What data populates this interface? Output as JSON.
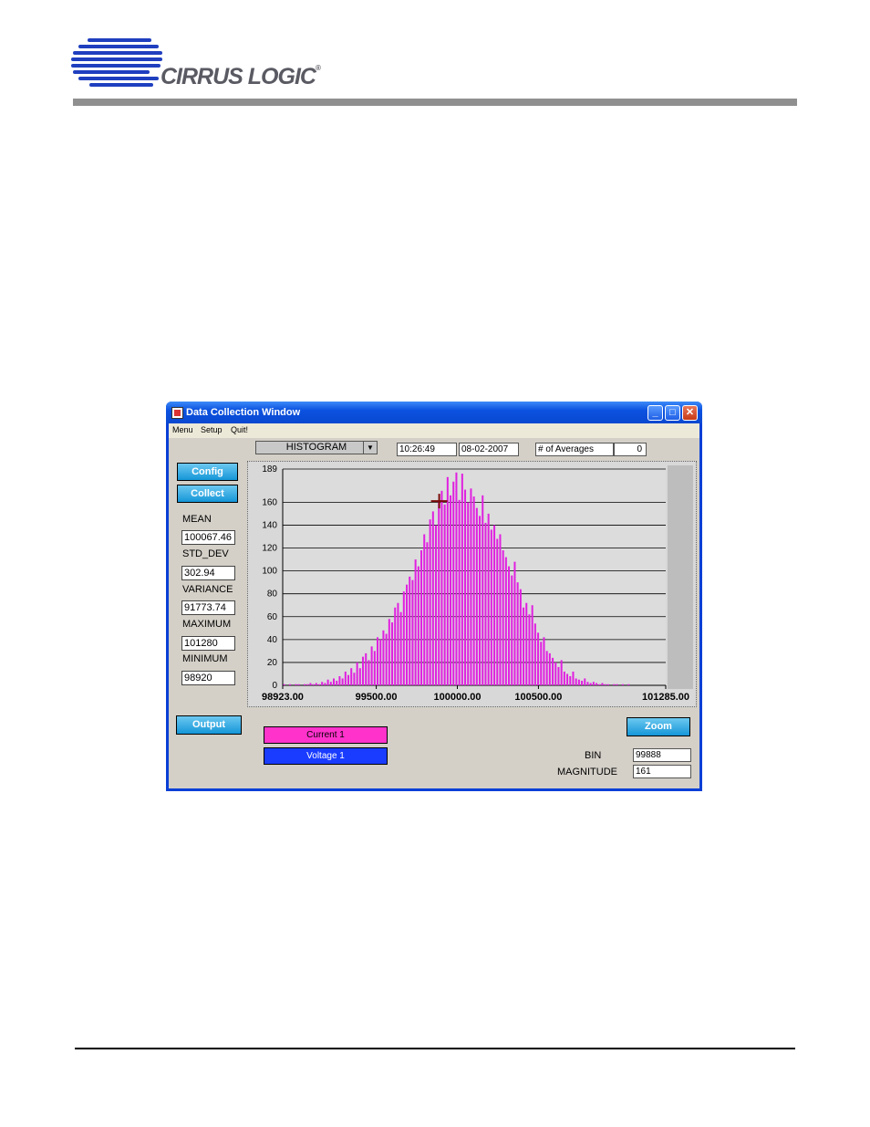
{
  "header": {
    "logo_text": "CIRRUS LOGIC",
    "logo_reg": "®",
    "brand_color": "#1f3fbf",
    "bar_color": "#8f8f8f"
  },
  "window": {
    "title": "Data Collection Window",
    "controls": {
      "minimize": "_",
      "maximize": "□",
      "close": "✕"
    },
    "menu": [
      "Menu",
      "Setup",
      "Quit!"
    ]
  },
  "toolbar": {
    "mode": "HISTOGRAM",
    "time": "10:26:49",
    "date": "08-02-2007",
    "averages_label": "# of Averages",
    "averages_value": "0"
  },
  "buttons": {
    "config": "Config",
    "collect": "Collect",
    "output": "Output",
    "zoom": "Zoom"
  },
  "stats": {
    "mean_label": "MEAN",
    "mean": "100067.46",
    "std_label": "STD_DEV",
    "std": "302.94",
    "variance_label": "VARIANCE",
    "variance": "91773.74",
    "max_label": "MAXIMUM",
    "max": "101280",
    "min_label": "MINIMUM",
    "min": "98920"
  },
  "legend": {
    "current": "Current 1",
    "voltage": "Voltage 1",
    "current_color": "#ff33cc",
    "voltage_color": "#1a3cff"
  },
  "cursor": {
    "bin_label": "BIN",
    "bin": "99888",
    "magnitude_label": "MAGNITUDE",
    "magnitude": "161"
  },
  "chart_data": {
    "type": "bar",
    "color": "#e020e0",
    "xlim": [
      98923.0,
      101285.0
    ],
    "ylim": [
      0,
      189
    ],
    "x_ticks": [
      "98923.00",
      "99500.00",
      "100000.00",
      "100500.00",
      "101285.00"
    ],
    "x_tick_values": [
      98923,
      99500,
      100000,
      100500,
      101285
    ],
    "y_ticks": [
      0,
      20,
      40,
      60,
      80,
      100,
      120,
      140,
      160,
      189
    ],
    "grid": true,
    "cursor_x": 99888,
    "cursor_y": 161,
    "bin_width": 18,
    "bins_start": 98932,
    "values": [
      1,
      0,
      1,
      0,
      1,
      1,
      0,
      1,
      1,
      2,
      1,
      2,
      1,
      3,
      2,
      5,
      3,
      6,
      4,
      8,
      6,
      12,
      9,
      15,
      11,
      20,
      15,
      25,
      28,
      22,
      34,
      30,
      42,
      40,
      48,
      45,
      58,
      55,
      68,
      72,
      64,
      82,
      88,
      95,
      92,
      110,
      104,
      118,
      132,
      125,
      145,
      152,
      140,
      160,
      170,
      158,
      182,
      166,
      178,
      186,
      162,
      185,
      171,
      160,
      172,
      165,
      155,
      148,
      166,
      142,
      150,
      136,
      140,
      128,
      132,
      118,
      112,
      104,
      96,
      108,
      90,
      84,
      68,
      72,
      62,
      70,
      54,
      46,
      38,
      42,
      30,
      28,
      24,
      20,
      16,
      22,
      12,
      10,
      8,
      12,
      6,
      5,
      4,
      6,
      3,
      2,
      3,
      2,
      1,
      2,
      1,
      1,
      0,
      1,
      1,
      0,
      1,
      0,
      1
    ]
  }
}
